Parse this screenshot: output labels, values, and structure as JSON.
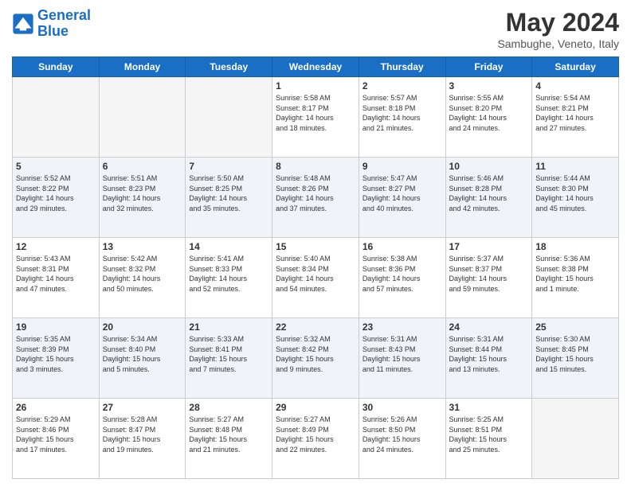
{
  "header": {
    "logo_line1": "General",
    "logo_line2": "Blue",
    "month_year": "May 2024",
    "location": "Sambughe, Veneto, Italy"
  },
  "days_of_week": [
    "Sunday",
    "Monday",
    "Tuesday",
    "Wednesday",
    "Thursday",
    "Friday",
    "Saturday"
  ],
  "weeks": [
    [
      {
        "day": "",
        "info": ""
      },
      {
        "day": "",
        "info": ""
      },
      {
        "day": "",
        "info": ""
      },
      {
        "day": "1",
        "info": "Sunrise: 5:58 AM\nSunset: 8:17 PM\nDaylight: 14 hours\nand 18 minutes."
      },
      {
        "day": "2",
        "info": "Sunrise: 5:57 AM\nSunset: 8:18 PM\nDaylight: 14 hours\nand 21 minutes."
      },
      {
        "day": "3",
        "info": "Sunrise: 5:55 AM\nSunset: 8:20 PM\nDaylight: 14 hours\nand 24 minutes."
      },
      {
        "day": "4",
        "info": "Sunrise: 5:54 AM\nSunset: 8:21 PM\nDaylight: 14 hours\nand 27 minutes."
      }
    ],
    [
      {
        "day": "5",
        "info": "Sunrise: 5:52 AM\nSunset: 8:22 PM\nDaylight: 14 hours\nand 29 minutes."
      },
      {
        "day": "6",
        "info": "Sunrise: 5:51 AM\nSunset: 8:23 PM\nDaylight: 14 hours\nand 32 minutes."
      },
      {
        "day": "7",
        "info": "Sunrise: 5:50 AM\nSunset: 8:25 PM\nDaylight: 14 hours\nand 35 minutes."
      },
      {
        "day": "8",
        "info": "Sunrise: 5:48 AM\nSunset: 8:26 PM\nDaylight: 14 hours\nand 37 minutes."
      },
      {
        "day": "9",
        "info": "Sunrise: 5:47 AM\nSunset: 8:27 PM\nDaylight: 14 hours\nand 40 minutes."
      },
      {
        "day": "10",
        "info": "Sunrise: 5:46 AM\nSunset: 8:28 PM\nDaylight: 14 hours\nand 42 minutes."
      },
      {
        "day": "11",
        "info": "Sunrise: 5:44 AM\nSunset: 8:30 PM\nDaylight: 14 hours\nand 45 minutes."
      }
    ],
    [
      {
        "day": "12",
        "info": "Sunrise: 5:43 AM\nSunset: 8:31 PM\nDaylight: 14 hours\nand 47 minutes."
      },
      {
        "day": "13",
        "info": "Sunrise: 5:42 AM\nSunset: 8:32 PM\nDaylight: 14 hours\nand 50 minutes."
      },
      {
        "day": "14",
        "info": "Sunrise: 5:41 AM\nSunset: 8:33 PM\nDaylight: 14 hours\nand 52 minutes."
      },
      {
        "day": "15",
        "info": "Sunrise: 5:40 AM\nSunset: 8:34 PM\nDaylight: 14 hours\nand 54 minutes."
      },
      {
        "day": "16",
        "info": "Sunrise: 5:38 AM\nSunset: 8:36 PM\nDaylight: 14 hours\nand 57 minutes."
      },
      {
        "day": "17",
        "info": "Sunrise: 5:37 AM\nSunset: 8:37 PM\nDaylight: 14 hours\nand 59 minutes."
      },
      {
        "day": "18",
        "info": "Sunrise: 5:36 AM\nSunset: 8:38 PM\nDaylight: 15 hours\nand 1 minute."
      }
    ],
    [
      {
        "day": "19",
        "info": "Sunrise: 5:35 AM\nSunset: 8:39 PM\nDaylight: 15 hours\nand 3 minutes."
      },
      {
        "day": "20",
        "info": "Sunrise: 5:34 AM\nSunset: 8:40 PM\nDaylight: 15 hours\nand 5 minutes."
      },
      {
        "day": "21",
        "info": "Sunrise: 5:33 AM\nSunset: 8:41 PM\nDaylight: 15 hours\nand 7 minutes."
      },
      {
        "day": "22",
        "info": "Sunrise: 5:32 AM\nSunset: 8:42 PM\nDaylight: 15 hours\nand 9 minutes."
      },
      {
        "day": "23",
        "info": "Sunrise: 5:31 AM\nSunset: 8:43 PM\nDaylight: 15 hours\nand 11 minutes."
      },
      {
        "day": "24",
        "info": "Sunrise: 5:31 AM\nSunset: 8:44 PM\nDaylight: 15 hours\nand 13 minutes."
      },
      {
        "day": "25",
        "info": "Sunrise: 5:30 AM\nSunset: 8:45 PM\nDaylight: 15 hours\nand 15 minutes."
      }
    ],
    [
      {
        "day": "26",
        "info": "Sunrise: 5:29 AM\nSunset: 8:46 PM\nDaylight: 15 hours\nand 17 minutes."
      },
      {
        "day": "27",
        "info": "Sunrise: 5:28 AM\nSunset: 8:47 PM\nDaylight: 15 hours\nand 19 minutes."
      },
      {
        "day": "28",
        "info": "Sunrise: 5:27 AM\nSunset: 8:48 PM\nDaylight: 15 hours\nand 21 minutes."
      },
      {
        "day": "29",
        "info": "Sunrise: 5:27 AM\nSunset: 8:49 PM\nDaylight: 15 hours\nand 22 minutes."
      },
      {
        "day": "30",
        "info": "Sunrise: 5:26 AM\nSunset: 8:50 PM\nDaylight: 15 hours\nand 24 minutes."
      },
      {
        "day": "31",
        "info": "Sunrise: 5:25 AM\nSunset: 8:51 PM\nDaylight: 15 hours\nand 25 minutes."
      },
      {
        "day": "",
        "info": ""
      }
    ]
  ]
}
